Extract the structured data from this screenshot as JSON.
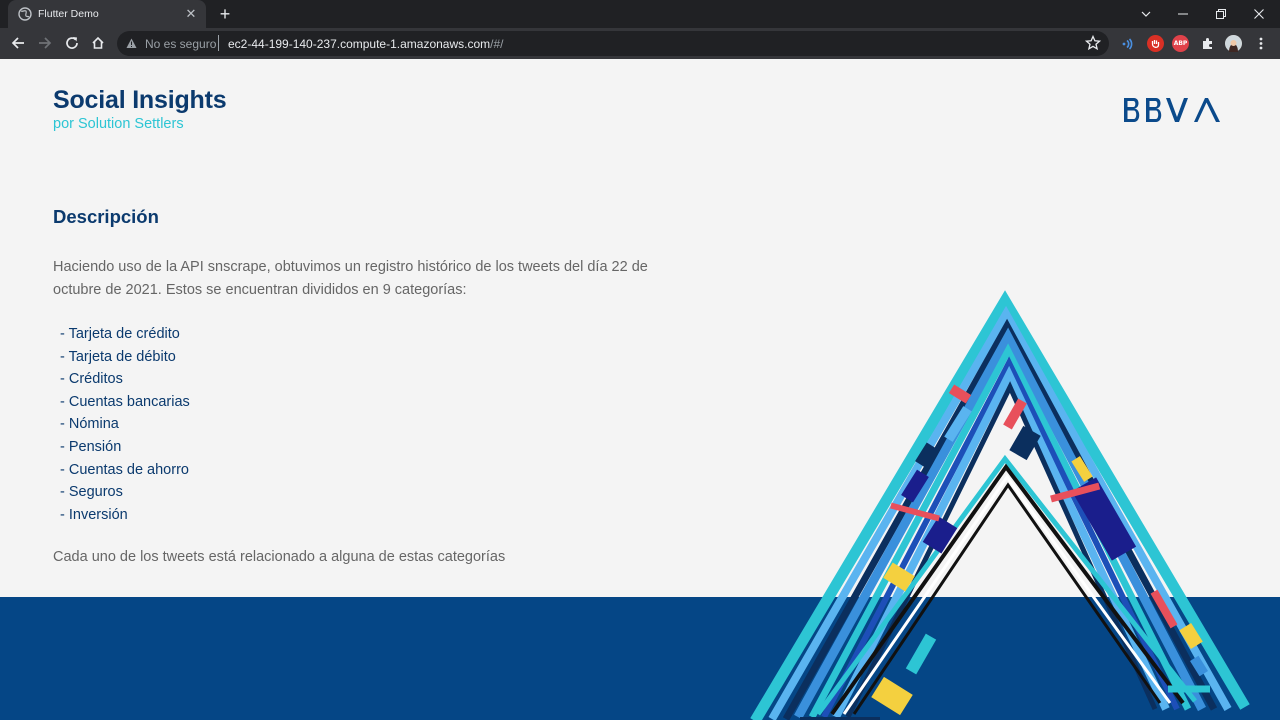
{
  "browser": {
    "tab_title": "Flutter Demo",
    "security_label": "No es seguro",
    "url_host": "ec2-44-199-140-237.compute-1.amazonaws.com",
    "url_path": "/#/"
  },
  "header": {
    "title": "Social Insights",
    "subtitle": "por Solution Settlers",
    "logo_text": "BBVA"
  },
  "description": {
    "heading": "Descripción",
    "intro": "Haciendo uso de la API snscrape, obtuvimos un registro histórico de los tweets del día 22 de octubre de 2021. Estos se encuentran divididos en 9 categorías:",
    "categories": [
      "- Tarjeta de crédito",
      "- Tarjeta de débito",
      "- Créditos",
      "- Cuentas bancarias",
      "- Nómina",
      "- Pensión",
      "- Cuentas de ahorro",
      "- Seguros",
      "- Inversión"
    ],
    "footnote": "Cada uno de los tweets está relacionado a alguna de estas categorías"
  },
  "colors": {
    "brand_navy": "#0b3a6e",
    "accent_cyan": "#2dc5d4",
    "footer_blue": "#054686"
  }
}
